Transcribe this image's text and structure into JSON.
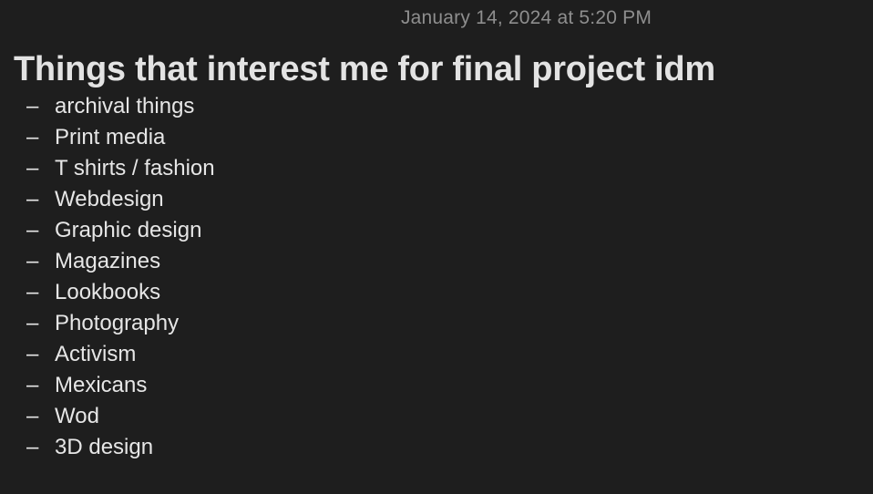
{
  "note": {
    "timestamp": "January 14, 2024 at 5:20 PM",
    "title": "Things that interest me for final project idm",
    "bullet": "–",
    "items": [
      "archival things",
      "Print media",
      "T shirts / fashion",
      "Webdesign",
      "Graphic design",
      "Magazines",
      "Lookbooks",
      "Photography",
      "Activism",
      "Mexicans",
      "Wod",
      "3D design"
    ]
  },
  "colors": {
    "background": "#1e1e1e",
    "text": "#e6e6e6",
    "timestamp": "#8e8e8e"
  }
}
